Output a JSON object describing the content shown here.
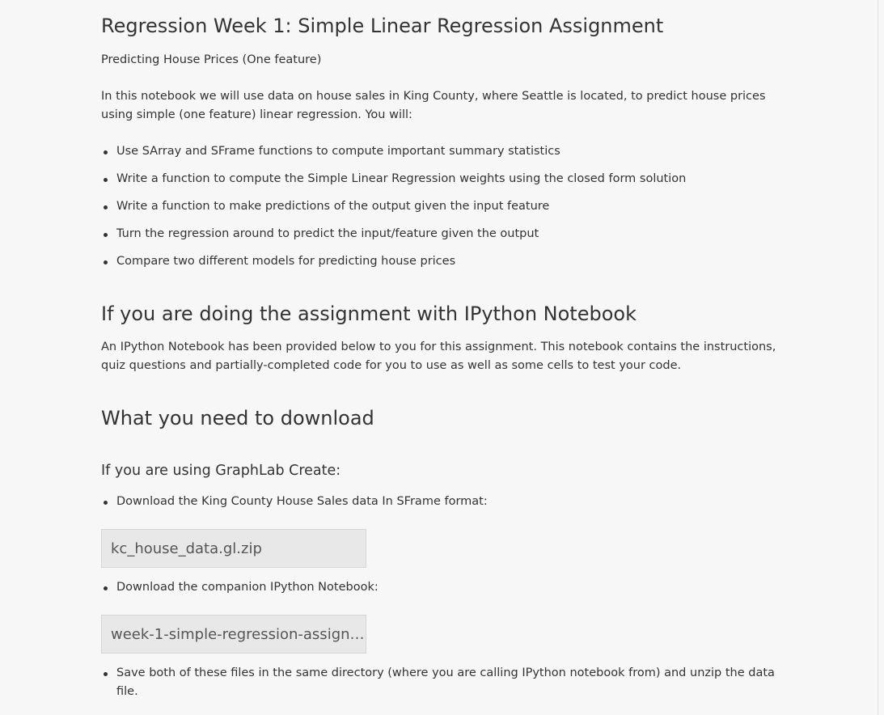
{
  "page": {
    "title": "Regression Week 1: Simple Linear Regression Assignment",
    "subtitle": "Predicting House Prices (One feature)",
    "intro": "In this notebook we will use data on house sales in King County, where Seattle is located, to predict house prices using simple (one feature) linear regression. You will:",
    "goals": [
      "Use SArray and SFrame functions to compute important summary statistics",
      "Write a function to compute the Simple Linear Regression weights using the closed form solution",
      "Write a function to make predictions of the output given the input feature",
      "Turn the regression around to predict the input/feature given the output",
      "Compare two different models for predicting house prices"
    ]
  },
  "ipython_section": {
    "heading": "If you are doing the assignment with IPython Notebook",
    "body": "An IPython Notebook has been provided below to you for this assignment. This notebook contains the instructions, quiz questions and partially-completed code for you to use as well as some cells to test your code."
  },
  "download_section": {
    "heading": "What you need to download",
    "subheading": "If you are using GraphLab Create:",
    "step1": "Download the King County House Sales data In SFrame format:",
    "file1": "kc_house_data.gl.zip",
    "step2": "Download the companion IPython Notebook:",
    "file2": "week-1-simple-regression-assignme...",
    "step3": "Save both of these files in the same directory (where you are calling IPython notebook from) and unzip the data file."
  }
}
